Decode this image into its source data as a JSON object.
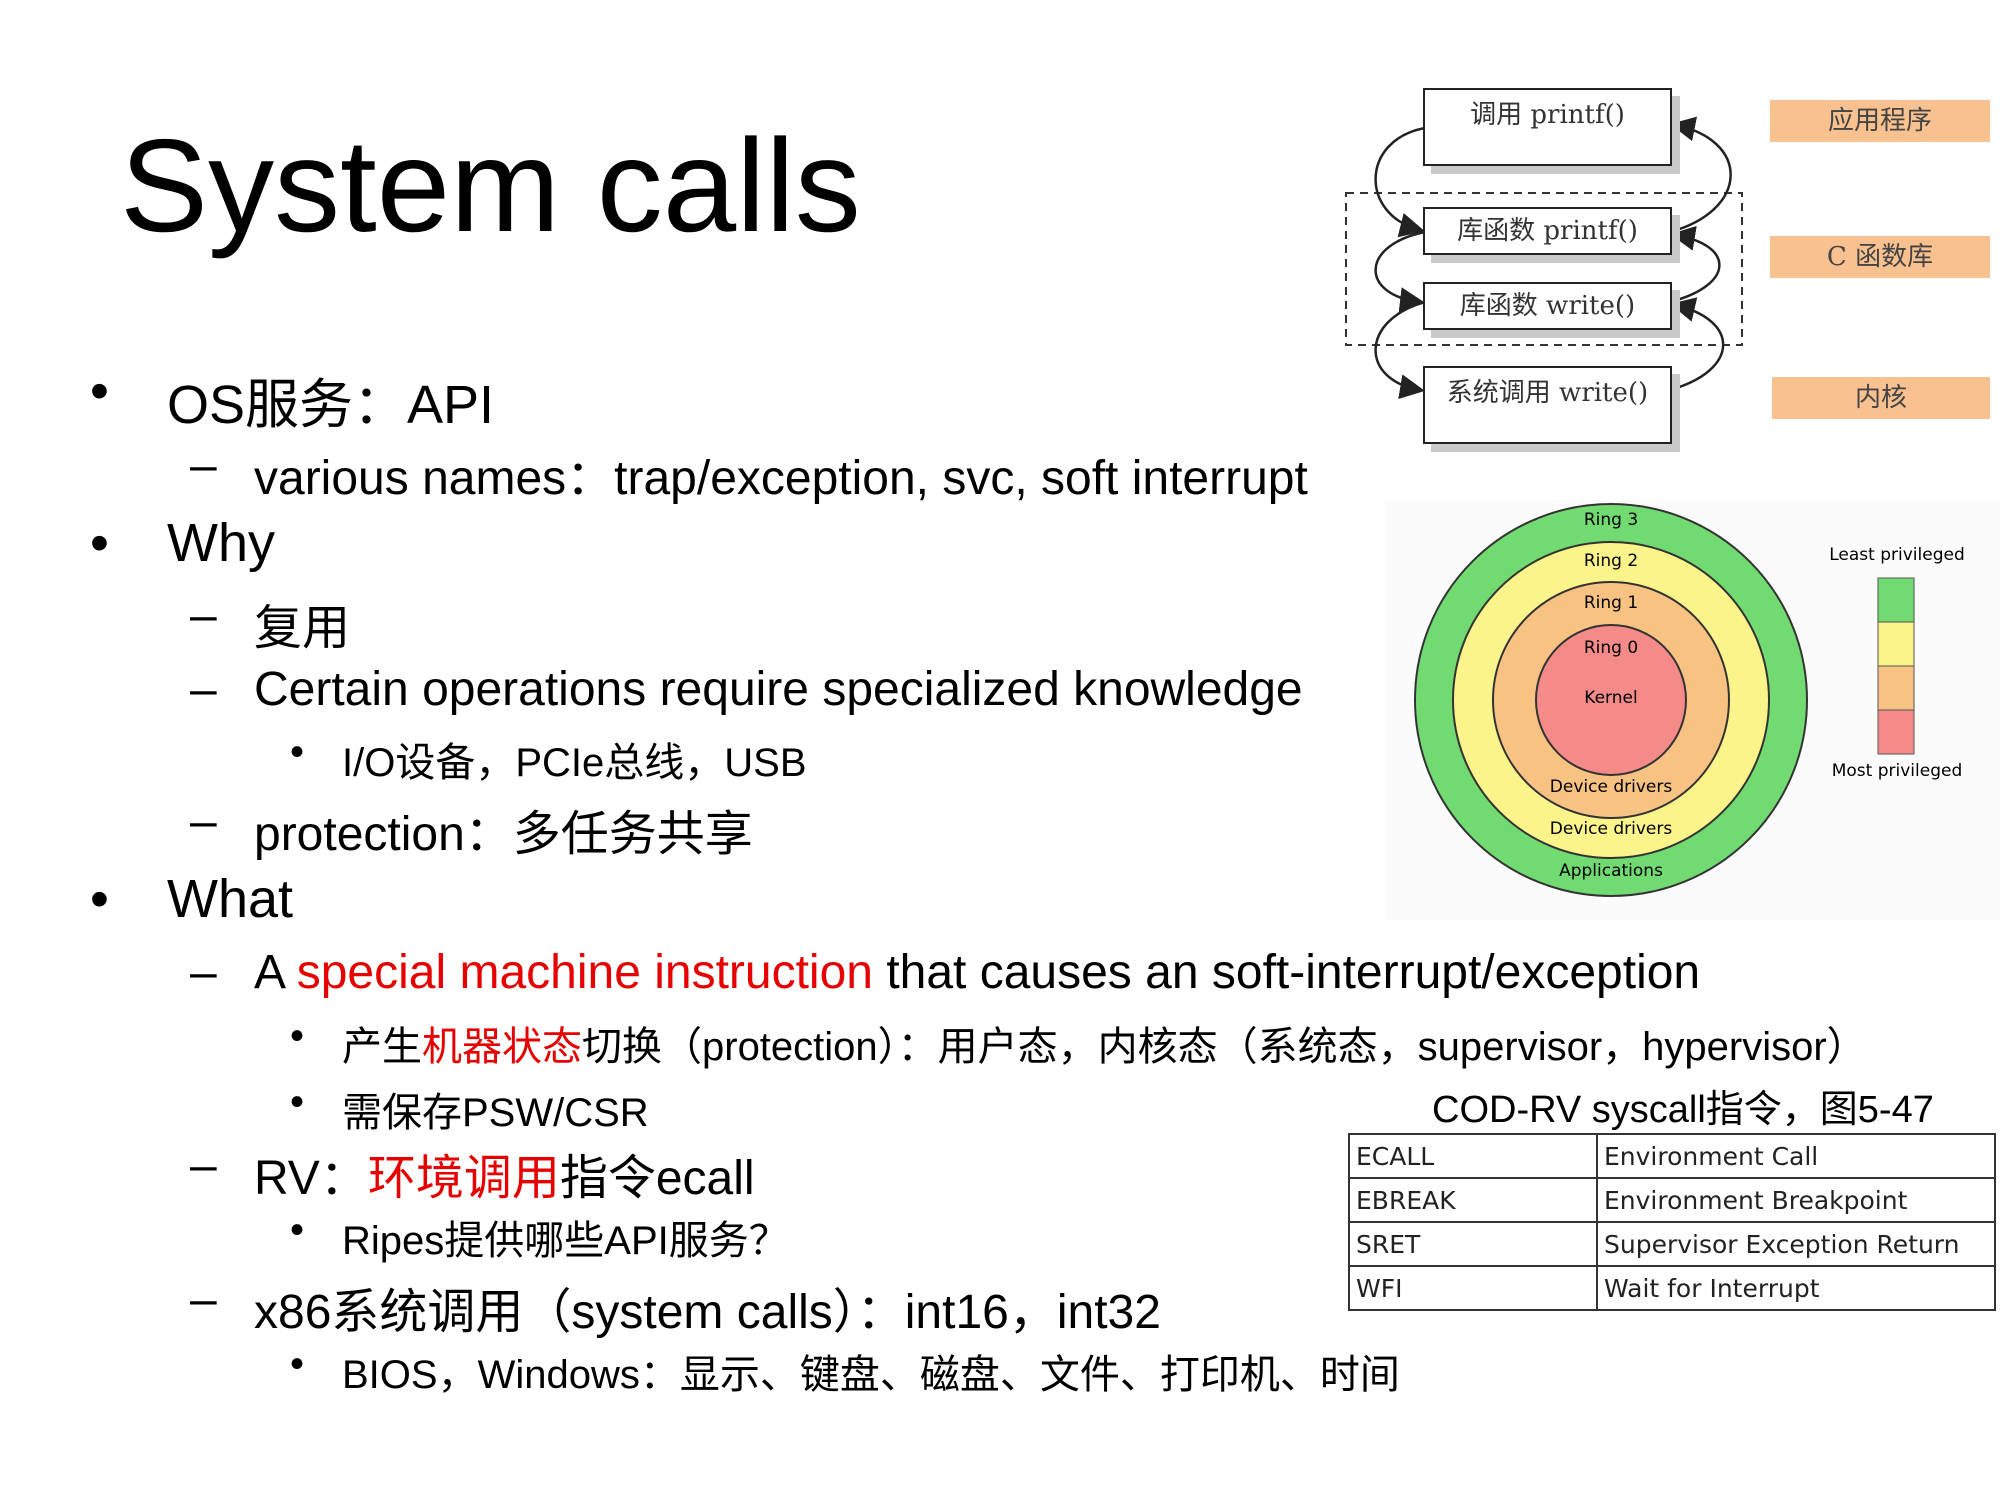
{
  "title": "System calls",
  "bullets": [
    {
      "id": "os",
      "level": 1,
      "text": "OS服务：API"
    },
    {
      "id": "names",
      "level": 2,
      "text": "various names：trap/exception, svc, soft interrupt"
    },
    {
      "id": "why",
      "level": 1,
      "text": "Why"
    },
    {
      "id": "reuse",
      "level": 2,
      "text": "复用"
    },
    {
      "id": "certain",
      "level": 2,
      "text": "Certain operations require specialized knowledge"
    },
    {
      "id": "io",
      "level": 3,
      "text": "I/O设备，PCIe总线，USB"
    },
    {
      "id": "protection",
      "level": 2,
      "text": "protection：多任务共享"
    },
    {
      "id": "what",
      "level": 1,
      "text": "What"
    },
    {
      "id": "special",
      "level": 2,
      "pre": "A ",
      "red": "special machine instruction",
      "post": " that causes an soft-interrupt/exception"
    },
    {
      "id": "state",
      "level": 3,
      "pre": "产生",
      "red": "机器状态",
      "post": "切换（protection）：用户态，内核态（系统态，supervisor，hypervisor）"
    },
    {
      "id": "psw",
      "level": 3,
      "text": "需保存PSW/CSR"
    },
    {
      "id": "rv",
      "level": 2,
      "pre": "RV：",
      "red": "环境调用",
      "post": "指令ecall"
    },
    {
      "id": "ripes",
      "level": 3,
      "text": "Ripes提供哪些API服务？"
    },
    {
      "id": "x86",
      "level": 2,
      "text": "x86系统调用（system calls）：int16，int32"
    },
    {
      "id": "bios",
      "level": 3,
      "text": "BIOS，Windows：显示、键盘、磁盘、文件、打印机、时间"
    }
  ],
  "bullet_glyphs": {
    "level1": "•",
    "level2": "–",
    "level3": "•"
  },
  "printf_diagram": {
    "boxes": [
      "调用 printf()",
      "库函数 printf()",
      "库函数 write()",
      "系统调用 write()"
    ],
    "labels": [
      "应用程序",
      "C 函数库",
      "内核"
    ]
  },
  "rings": {
    "ring_labels": [
      "Ring 3",
      "Ring 2",
      "Ring 1",
      "Ring 0"
    ],
    "center_label": "Kernel",
    "inner_labels": [
      "Device drivers",
      "Device drivers",
      "Applications"
    ],
    "least": "Least privileged",
    "most": "Most privileged",
    "colors": [
      "#71db71",
      "#fbf48a",
      "#f7c282",
      "#f58b89"
    ]
  },
  "table_caption": "COD-RV syscall指令，图5-47",
  "instr_table": [
    [
      "ECALL",
      "Environment Call"
    ],
    [
      "EBREAK",
      "Environment Breakpoint"
    ],
    [
      "SRET",
      "Supervisor Exception Return"
    ],
    [
      "WFI",
      "Wait for Interrupt"
    ]
  ]
}
